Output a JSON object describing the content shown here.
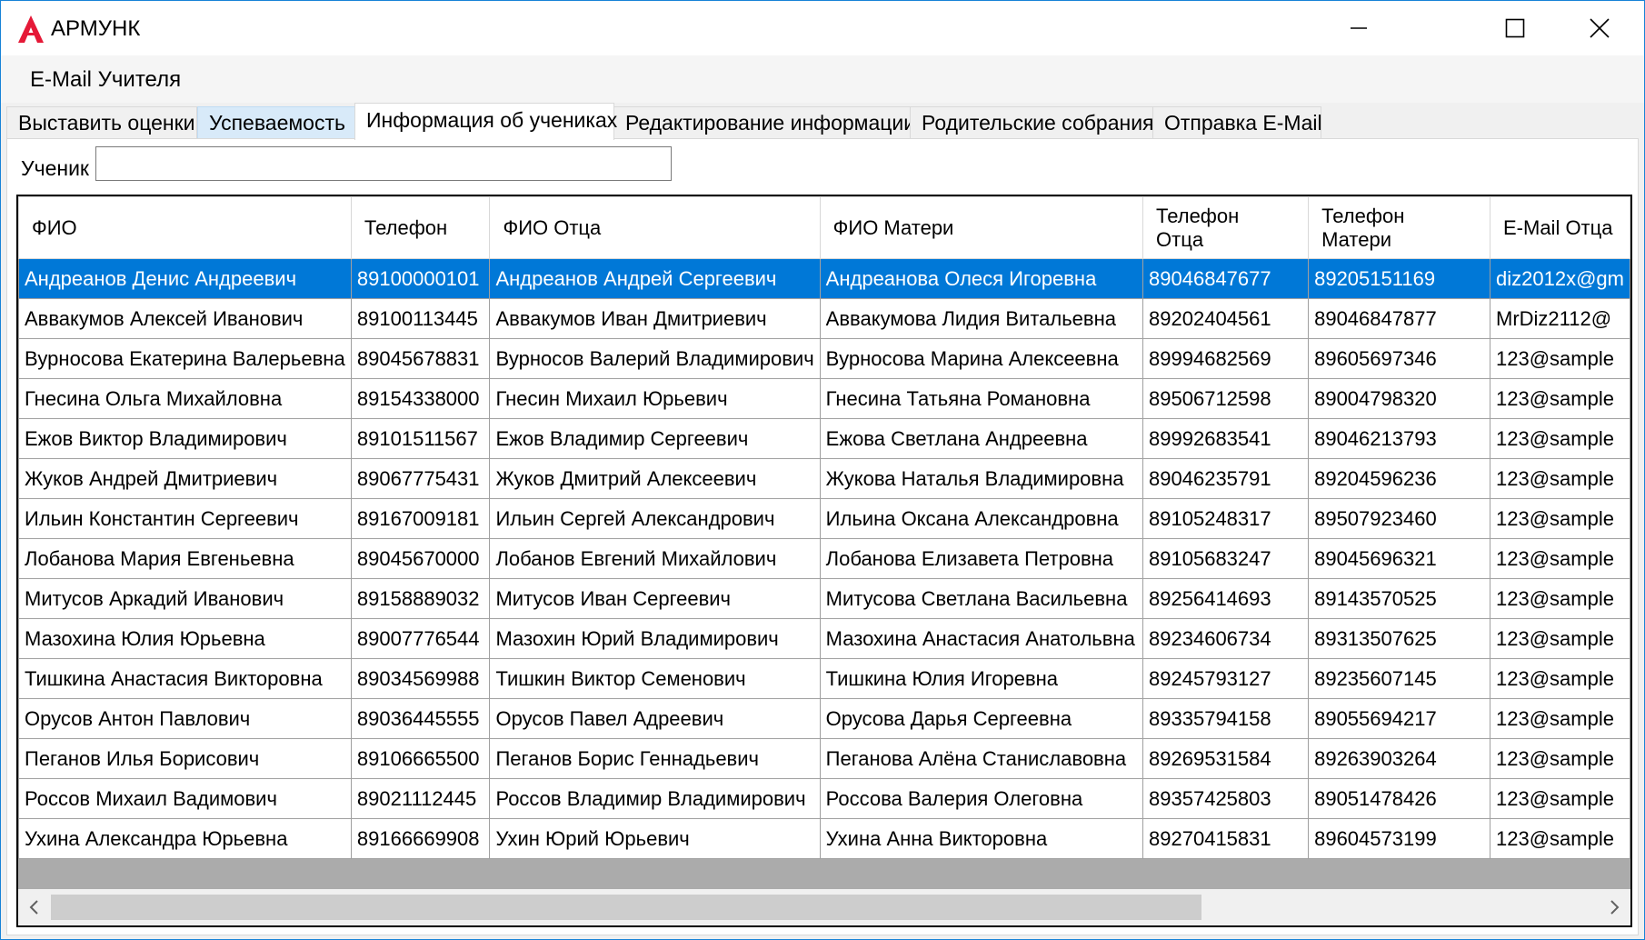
{
  "window": {
    "title": "АРМУНК"
  },
  "menu": {
    "items": [
      {
        "label": "E-Mail Учителя"
      }
    ]
  },
  "tabs": [
    {
      "label": "Выставить оценки"
    },
    {
      "label": "Успеваемость"
    },
    {
      "label": "Информация об учениках"
    },
    {
      "label": "Редактирование информации"
    },
    {
      "label": "Родительские собрания"
    },
    {
      "label": "Отправка E-Mail"
    }
  ],
  "search": {
    "label": "Ученик",
    "value": ""
  },
  "grid": {
    "columns": [
      "ФИО",
      "Телефон",
      "ФИО Отца",
      "ФИО Матери",
      "Телефон\nОтца",
      "Телефон\nМатери",
      "E-Mail Отца"
    ],
    "selected_row": 0,
    "rows": [
      [
        "Андреанов Денис Андреевич",
        "89100000101",
        "Андреанов Андрей Сергеевич",
        "Андреанова Олеся Игоревна",
        "89046847677",
        "89205151169",
        "diz2012x@gm"
      ],
      [
        "Аввакумов Алексей Иванович",
        "89100113445",
        "Аввакумов Иван Дмитриевич",
        "Аввакумова Лидия Витальевна",
        "89202404561",
        "89046847877",
        "MrDiz2112@"
      ],
      [
        "Вурносова Екатерина Валерьевна",
        "89045678831",
        "Вурносов Валерий Владимирович",
        "Вурносова Марина Алексеевна",
        "89994682569",
        "89605697346",
        "123@sample"
      ],
      [
        "Гнесина Ольга Михайловна",
        "89154338000",
        "Гнесин Михаил Юрьевич",
        "Гнесина Татьяна Романовна",
        "89506712598",
        "89004798320",
        "123@sample"
      ],
      [
        "Ежов Виктор Владимирович",
        "89101511567",
        "Ежов Владимир Сергеевич",
        "Ежова Светлана Андреевна",
        "89992683541",
        "89046213793",
        "123@sample"
      ],
      [
        "Жуков Андрей Дмитриевич",
        "89067775431",
        "Жуков Дмитрий Алексеевич",
        "Жукова Наталья Владимировна",
        "89046235791",
        "89204596236",
        "123@sample"
      ],
      [
        "Ильин Константин Сергеевич",
        "89167009181",
        "Ильин Сергей Александрович",
        "Ильина Оксана Александровна",
        "89105248317",
        "89507923460",
        "123@sample"
      ],
      [
        "Лобанова Мария Евгеньевна",
        "89045670000",
        "Лобанов Евгений Михайлович",
        "Лобанова Елизавета Петровна",
        "89105683247",
        "89045696321",
        "123@sample"
      ],
      [
        "Митусов Аркадий Иванович",
        "89158889032",
        "Митусов Иван Сергеевич",
        "Митусова Светлана Васильевна",
        "89256414693",
        "89143570525",
        "123@sample"
      ],
      [
        "Мазохина Юлия Юрьевна",
        "89007776544",
        "Мазохин Юрий Владимирович",
        "Мазохина Анастасия Анатольвна",
        "89234606734",
        "89313507625",
        "123@sample"
      ],
      [
        "Тишкина Анастасия Викторовна",
        "89034569988",
        "Тишкин Виктор Семенович",
        "Тишкина Юлия Игоревна",
        "89245793127",
        "89235607145",
        "123@sample"
      ],
      [
        "Орусов Антон Павлович",
        "89036445555",
        "Орусов Павел Адреевич",
        "Орусова Дарья Сергеевна",
        "89335794158",
        "89055694217",
        "123@sample"
      ],
      [
        "Пеганов Илья Борисович",
        "89106665500",
        "Пеганов Борис Геннадьевич",
        "Пеганова Алёна Станиславовна",
        "89269531584",
        "89263903264",
        "123@sample"
      ],
      [
        "Россов Михаил Вадимович",
        "89021112445",
        "Россов Владимир Владимирович",
        "Россова Валерия Олеговна",
        "89357425803",
        "89051478426",
        "123@sample"
      ],
      [
        "Ухина Александра Юрьевна",
        "89166669908",
        "Ухин Юрий Юрьевич",
        "Ухина Анна Викторовна",
        "89270415831",
        "89604573199",
        "123@sample"
      ]
    ]
  },
  "scrollbar": {
    "position": 0
  },
  "colors": {
    "selection": "#0078d7",
    "window_border": "#1883d7",
    "app_icon": "#e51937",
    "grid_background": "#ababab"
  }
}
